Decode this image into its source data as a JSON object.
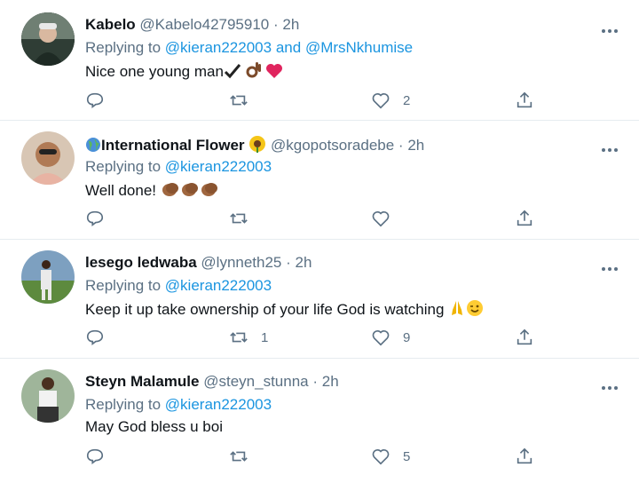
{
  "tweets": [
    {
      "name": "Kabelo",
      "handle": "@Kabelo42795910",
      "sep": "·",
      "time": "2h",
      "reply_prefix": "Replying to",
      "reply_to": "@kieran222003",
      "reply_and": "and",
      "reply_to2": "@MrsNkhumise",
      "text": "Nice one young man",
      "reply_count": "",
      "retweet_count": "",
      "like_count": "2"
    },
    {
      "name": "International Flower",
      "handle": "@kgopotsoradebe",
      "sep": "·",
      "time": "2h",
      "reply_prefix": "Replying to",
      "reply_to": "@kieran222003",
      "text": "Well done!",
      "reply_count": "",
      "retweet_count": "",
      "like_count": ""
    },
    {
      "name": "lesego ledwaba",
      "handle": "@lynneth25",
      "sep": "·",
      "time": "2h",
      "reply_prefix": "Replying to",
      "reply_to": "@kieran222003",
      "text": "Keep it up take ownership of your life God is watching",
      "reply_count": "",
      "retweet_count": "1",
      "like_count": "9"
    },
    {
      "name": "Steyn Malamule",
      "handle": "@steyn_stunna",
      "sep": "·",
      "time": "2h",
      "reply_prefix": "Replying to",
      "reply_to": "@kieran222003",
      "text": "May God bless u boi",
      "reply_count": "",
      "retweet_count": "",
      "like_count": "5"
    }
  ],
  "icons": {
    "reply": "reply-icon",
    "retweet": "retweet-icon",
    "like": "heart-icon",
    "share": "share-icon",
    "more": "more-icon"
  },
  "colors": {
    "link": "#1b95e0",
    "secondary": "#5b7083",
    "heart": "#e0245e"
  }
}
